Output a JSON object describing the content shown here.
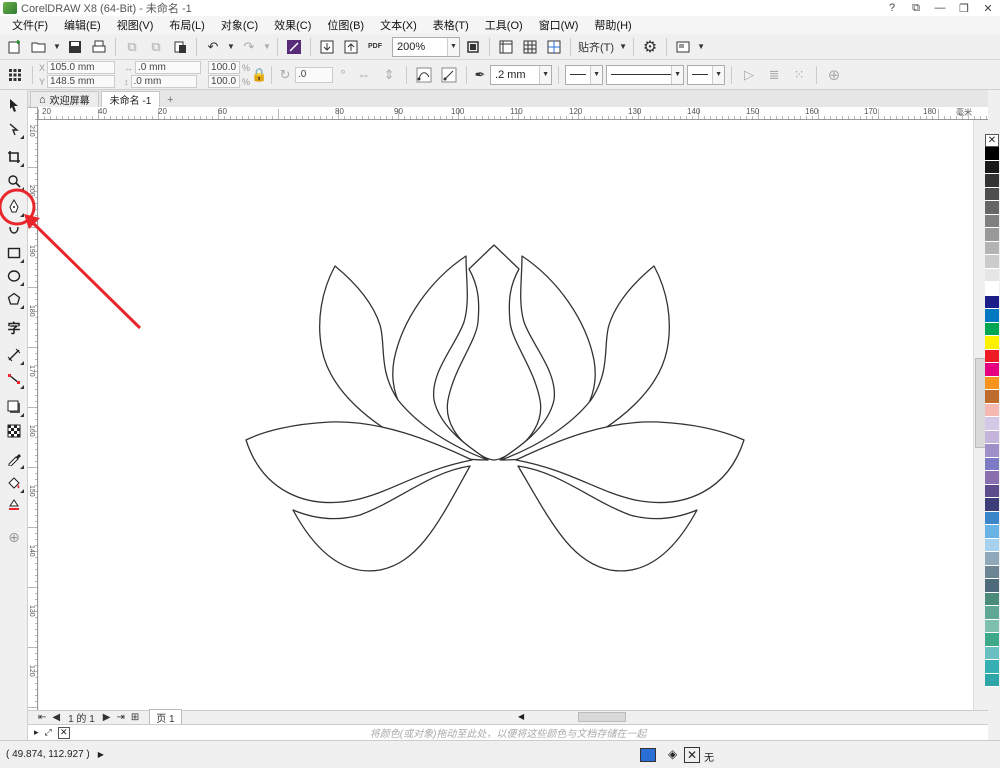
{
  "window": {
    "title": "CorelDRAW X8 (64-Bit) - 未命名 -1",
    "controls": [
      "?",
      "⧉",
      "—",
      "❐",
      "✕"
    ]
  },
  "menu": [
    "文件(F)",
    "编辑(E)",
    "视图(V)",
    "布局(L)",
    "对象(C)",
    "效果(C)",
    "位图(B)",
    "文本(X)",
    "表格(T)",
    "工具(O)",
    "窗口(W)",
    "帮助(H)"
  ],
  "toolbar": {
    "zoom_value": "200%",
    "snap_label": "贴齐(T)",
    "pdf_label": "PDF"
  },
  "propbar": {
    "x": "105.0 mm",
    "y": "148.5 mm",
    "w": ".0 mm",
    "h": ".0 mm",
    "sx": "100.0",
    "sy": "100.0",
    "pct": "%",
    "rotate": ".0",
    "outline_width": ".2 mm"
  },
  "tabs": [
    {
      "label": "欢迎屏幕",
      "active": false
    },
    {
      "label": "未命名 -1",
      "active": true
    }
  ],
  "ruler": {
    "h_ticks": [
      "20",
      "40",
      "60",
      "80",
      "90",
      "100",
      "110",
      "120",
      "130",
      "140",
      "150",
      "160",
      "170",
      "180"
    ],
    "h_unit": "毫米",
    "v_ticks": [
      "210",
      "200",
      "190",
      "180",
      "170",
      "160",
      "150",
      "140",
      "130",
      "120"
    ]
  },
  "pagebar": {
    "page_of": "1 的 1",
    "page_tab": "页 1"
  },
  "colorhint": {
    "text": "将颜色(或对象)拖动至此处，以便将这些颜色与文档存储在一起"
  },
  "status": {
    "coords": "( 49.874, 112.927 )",
    "fill_none": "无"
  },
  "palette": [
    "#000000",
    "#1a1a1a",
    "#333333",
    "#4d4d4d",
    "#666666",
    "#808080",
    "#999999",
    "#b3b3b3",
    "#cccccc",
    "#e6e6e6",
    "#ffffff",
    "#1b1f8a",
    "#0079c1",
    "#00a651",
    "#fff200",
    "#ed1c24",
    "#e4007f",
    "#f7941d",
    "#bf6b2e",
    "#f5b7b1",
    "#d5c8e6",
    "#c4b4dc",
    "#9f8fc8",
    "#7b7bc4",
    "#8a6fb0",
    "#5e4b8b",
    "#3d3d7a",
    "#3a86c8",
    "#69b3e7",
    "#a6d2f0",
    "#8fa7b8",
    "#6c8494",
    "#4e6b7b",
    "#4a8c7a",
    "#5fa898",
    "#7fbfad",
    "#3fa88a",
    "#6ac0c0",
    "#34b0b5",
    "#2ea6a8"
  ],
  "colors": {
    "annotation": "#e8262b",
    "shape_stroke": "#333333"
  }
}
